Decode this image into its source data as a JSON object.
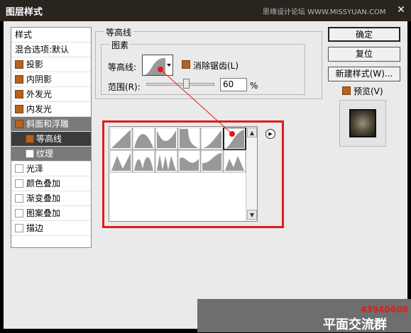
{
  "window": {
    "title": "图层样式",
    "watermark": "思缘设计论坛 WWW.MISSYUAN.COM",
    "close_label": "✕"
  },
  "style_list": {
    "header": "样式",
    "blend_options": "混合选项:默认",
    "items": [
      {
        "label": "投影",
        "checked": true
      },
      {
        "label": "内阴影",
        "checked": true
      },
      {
        "label": "外发光",
        "checked": true
      },
      {
        "label": "内发光",
        "checked": true
      },
      {
        "label": "斜面和浮雕",
        "checked": true
      },
      {
        "label": "等高线",
        "checked": true
      },
      {
        "label": "纹理",
        "checked": false
      },
      {
        "label": "光泽",
        "checked": false
      },
      {
        "label": "颜色叠加",
        "checked": false
      },
      {
        "label": "渐变叠加",
        "checked": false
      },
      {
        "label": "图案叠加",
        "checked": false
      },
      {
        "label": "描边",
        "checked": false
      }
    ]
  },
  "contour_panel": {
    "group_title": "等高线",
    "subgroup_title": "图素",
    "contour_label": "等高线:",
    "antialias_label": "消除锯齿(L)",
    "range_label": "范围(R):",
    "range_value": "60",
    "range_unit": "%",
    "range_fraction": 0.6
  },
  "buttons": {
    "ok": "确定",
    "reset": "复位",
    "new_style": "新建样式(W)...",
    "preview": "预览(V)"
  },
  "overlay": {
    "number": "43940608",
    "text": "平面交流群"
  },
  "colors": {
    "accent_orange": "#b4621f",
    "highlight_red": "#e01c1c",
    "selected_grey": "#7a7a7a"
  }
}
